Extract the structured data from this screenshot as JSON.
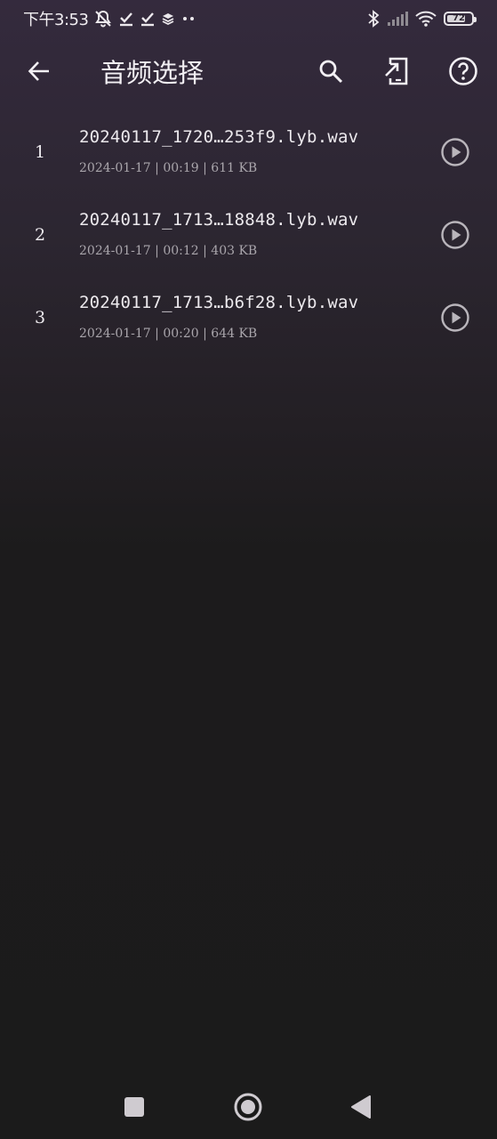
{
  "status_bar": {
    "time": "下午3:53",
    "battery_level": "72",
    "icons": [
      "mute-notification-icon",
      "check-icon",
      "check-icon",
      "layers-icon",
      "more-dots-icon",
      "bluetooth-icon",
      "signal-icon",
      "wifi-icon",
      "battery-icon"
    ]
  },
  "app_bar": {
    "title": "音频选择",
    "back_icon": "arrow-left-icon",
    "actions": [
      "search-icon",
      "import-icon",
      "help-icon"
    ]
  },
  "audio_list": [
    {
      "index": "1",
      "name": "20240117_1720…253f9.lyb.wav",
      "meta": "2024-01-17 | 00:19 | 611 KB"
    },
    {
      "index": "2",
      "name": "20240117_1713…18848.lyb.wav",
      "meta": "2024-01-17 | 00:12 | 403 KB"
    },
    {
      "index": "3",
      "name": "20240117_1713…b6f28.lyb.wav",
      "meta": "2024-01-17 | 00:20 | 644 KB"
    }
  ],
  "nav_bar": {
    "icons": [
      "recents-square-icon",
      "home-circle-icon",
      "back-triangle-icon"
    ]
  },
  "colors": {
    "background_top": "#342a3d",
    "background_bottom": "#1b1b1b",
    "text_primary": "#ece9ed",
    "text_secondary": "#a9a5ab"
  }
}
